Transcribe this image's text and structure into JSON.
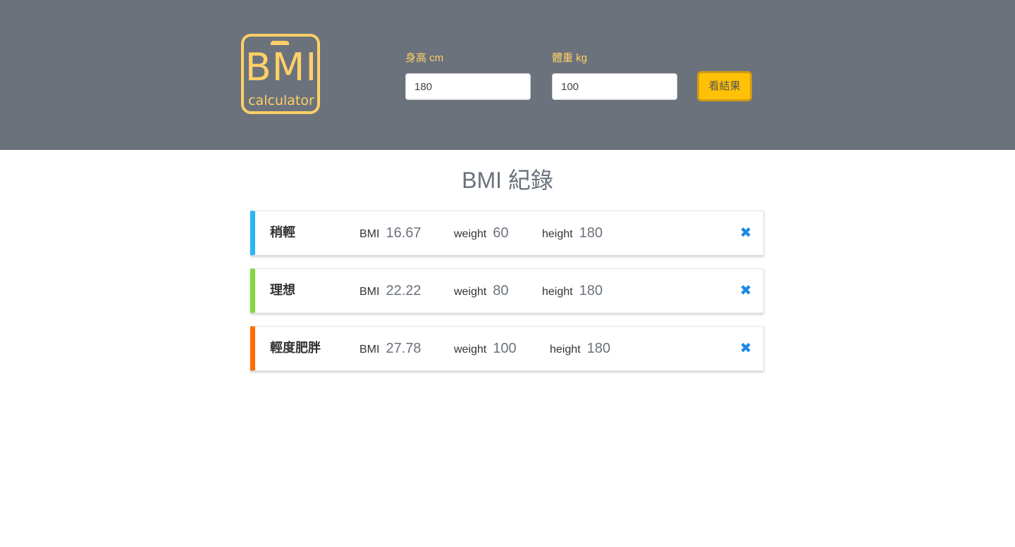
{
  "logo": {
    "title": "BMI",
    "subtitle": "calculator"
  },
  "form": {
    "height_label": "身高 cm",
    "height_value": "180",
    "weight_label": "體重 kg",
    "weight_value": "100",
    "submit_label": "看結果"
  },
  "records_title": "BMI 紀錄",
  "records": [
    {
      "status": "稍輕",
      "color": "#29b6f6",
      "bmi_label": "BMI",
      "bmi": "16.67",
      "weight_label": "weight",
      "weight": "60",
      "height_label": "height",
      "height": "180",
      "delete_icon": "✖"
    },
    {
      "status": "理想",
      "color": "#86d73f",
      "bmi_label": "BMI",
      "bmi": "22.22",
      "weight_label": "weight",
      "weight": "80",
      "height_label": "height",
      "height": "180",
      "delete_icon": "✖"
    },
    {
      "status": "輕度肥胖",
      "color": "#ff6c02",
      "bmi_label": "BMI",
      "bmi": "27.78",
      "weight_label": "weight",
      "weight": "100",
      "height_label": "height",
      "height": "180",
      "delete_icon": "✖"
    }
  ],
  "colors": {
    "header_bg": "#6b727c",
    "accent": "#ffd066",
    "button": "#ffc107",
    "delete": "#1e88e5"
  }
}
